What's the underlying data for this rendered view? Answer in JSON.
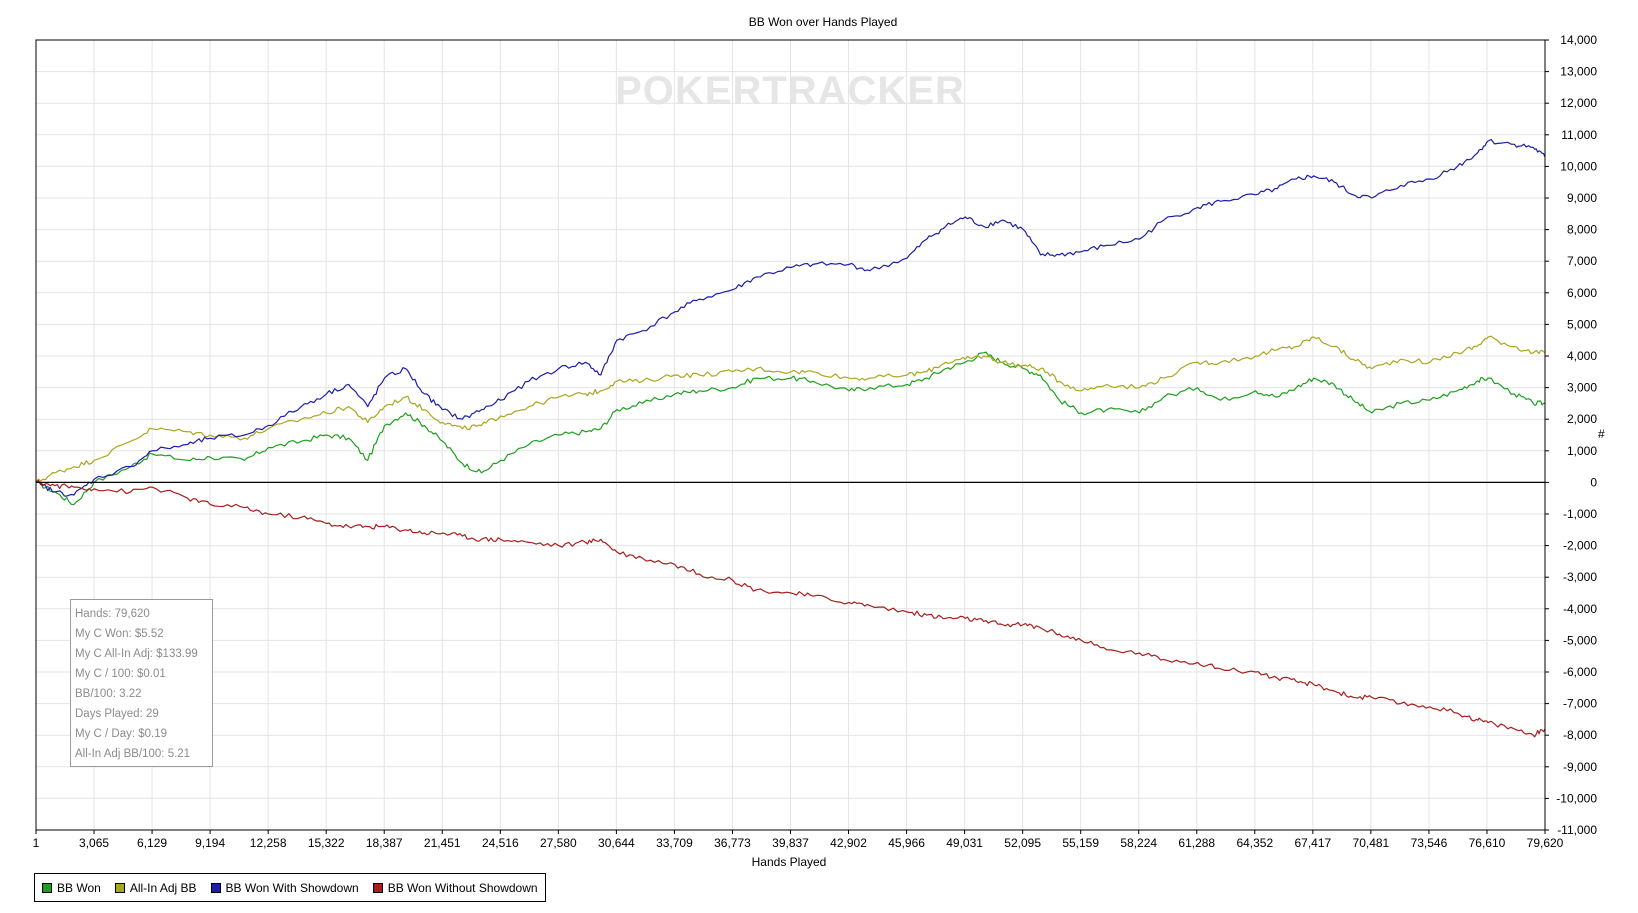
{
  "chart_data": {
    "type": "line",
    "title": "BB Won over Hands Played",
    "xlabel": "Hands Played",
    "ylabel": "",
    "watermark": "POKERTRACKER",
    "xlim": [
      1,
      79620
    ],
    "ylim": [
      -11000,
      14000
    ],
    "x_ticks": [
      "1",
      "3,065",
      "6,129",
      "9,194",
      "12,258",
      "15,322",
      "18,387",
      "21,451",
      "24,516",
      "27,580",
      "30,644",
      "33,709",
      "36,773",
      "39,837",
      "42,902",
      "45,966",
      "49,031",
      "52,095",
      "55,159",
      "58,224",
      "61,288",
      "64,352",
      "67,417",
      "70,481",
      "73,546",
      "76,610",
      "79,620"
    ],
    "y_ticks": [
      "14,000",
      "13,000",
      "12,000",
      "11,000",
      "10,000",
      "9,000",
      "8,000",
      "7,000",
      "6,000",
      "5,000",
      "4,000",
      "3,000",
      "2,000",
      "1,000",
      "0",
      "-1,000",
      "-2,000",
      "-3,000",
      "-4,000",
      "-5,000",
      "-6,000",
      "-7,000",
      "-8,000",
      "-9,000",
      "-10,000",
      "-11,000"
    ],
    "y_tick_values": [
      14000,
      13000,
      12000,
      11000,
      10000,
      9000,
      8000,
      7000,
      6000,
      5000,
      4000,
      3000,
      2000,
      1000,
      0,
      -1000,
      -2000,
      -3000,
      -4000,
      -5000,
      -6000,
      -7000,
      -8000,
      -9000,
      -10000,
      -11000
    ],
    "grid": true,
    "legend_position": "bottom-left",
    "right_axis_mark": "#",
    "series": [
      {
        "name": "BB Won",
        "color": "#1ea01e",
        "x": [
          1,
          1000,
          2000,
          3065,
          5000,
          6129,
          8000,
          9194,
          11000,
          12258,
          14000,
          15322,
          16500,
          17500,
          18387,
          19500,
          20500,
          21451,
          22500,
          23500,
          24516,
          26000,
          27580,
          29000,
          29800,
          30644,
          32000,
          33709,
          35000,
          36773,
          38000,
          39837,
          41000,
          42902,
          44000,
          45966,
          47000,
          48000,
          49031,
          50000,
          51000,
          52095,
          53000,
          54000,
          55159,
          56500,
          58224,
          59500,
          61288,
          62500,
          64352,
          65500,
          66500,
          67417,
          68500,
          69500,
          70481,
          72000,
          73546,
          75000,
          76000,
          76610,
          78000,
          79000,
          79620
        ],
        "y": [
          0,
          -300,
          -700,
          0,
          500,
          900,
          700,
          800,
          700,
          1100,
          1300,
          1500,
          1400,
          700,
          1800,
          2200,
          1800,
          1300,
          600,
          300,
          700,
          1200,
          1500,
          1600,
          1700,
          2300,
          2500,
          2800,
          2900,
          3000,
          3300,
          3300,
          3200,
          2900,
          3000,
          3100,
          3300,
          3600,
          3800,
          4100,
          3800,
          3600,
          3400,
          2600,
          2200,
          2300,
          2200,
          2700,
          3000,
          2600,
          2900,
          2700,
          3000,
          3300,
          3100,
          2600,
          2200,
          2500,
          2600,
          2900,
          3200,
          3300,
          2800,
          2500,
          2500
        ]
      },
      {
        "name": "All-In Adj BB",
        "color": "#a8a81e",
        "x": [
          1,
          1000,
          2000,
          3065,
          5000,
          6129,
          8000,
          9194,
          11000,
          12258,
          14000,
          15322,
          16500,
          17500,
          18387,
          19500,
          20500,
          21451,
          22500,
          23500,
          24516,
          26000,
          27580,
          29000,
          29800,
          30644,
          32000,
          33709,
          35000,
          36773,
          38000,
          39837,
          41000,
          42902,
          44000,
          45966,
          47000,
          48000,
          49031,
          50000,
          51000,
          52095,
          53000,
          54000,
          55159,
          56500,
          58224,
          59500,
          61288,
          62500,
          64352,
          65500,
          66500,
          67417,
          68500,
          69500,
          70481,
          72000,
          73546,
          75000,
          76000,
          76610,
          78000,
          79000,
          79620
        ],
        "y": [
          0,
          300,
          500,
          700,
          1300,
          1700,
          1600,
          1500,
          1400,
          1700,
          2000,
          2200,
          2400,
          1900,
          2400,
          2700,
          2300,
          1900,
          1700,
          1800,
          2100,
          2400,
          2700,
          2800,
          2900,
          3200,
          3200,
          3400,
          3400,
          3500,
          3600,
          3500,
          3500,
          3300,
          3300,
          3400,
          3500,
          3800,
          3900,
          4000,
          3800,
          3700,
          3600,
          3200,
          2900,
          3100,
          3000,
          3300,
          3800,
          3800,
          4000,
          4200,
          4300,
          4600,
          4300,
          3900,
          3600,
          3900,
          3800,
          4100,
          4300,
          4600,
          4300,
          4100,
          4100
        ]
      },
      {
        "name": "BB Won With Showdown",
        "color": "#1e1ea8",
        "x": [
          1,
          1000,
          2000,
          3065,
          5000,
          6129,
          8000,
          9194,
          11000,
          12258,
          14000,
          15322,
          16500,
          17500,
          18387,
          19500,
          20500,
          21451,
          22500,
          23500,
          24516,
          26000,
          27580,
          29000,
          29800,
          30644,
          32000,
          33709,
          35000,
          36773,
          38000,
          39837,
          41000,
          42902,
          44000,
          45966,
          47000,
          48000,
          49031,
          50000,
          51000,
          52095,
          53000,
          54000,
          55159,
          56500,
          58224,
          59500,
          61288,
          62500,
          64352,
          65500,
          66500,
          67417,
          68500,
          69500,
          70481,
          72000,
          73546,
          75000,
          76000,
          76610,
          78000,
          79000,
          79620
        ],
        "y": [
          0,
          -300,
          -400,
          100,
          500,
          1000,
          1200,
          1400,
          1500,
          1800,
          2400,
          2800,
          3100,
          2400,
          3300,
          3600,
          2800,
          2300,
          2000,
          2300,
          2600,
          3200,
          3600,
          3800,
          3400,
          4500,
          4800,
          5400,
          5800,
          6100,
          6500,
          6800,
          6900,
          6900,
          6700,
          7100,
          7700,
          8100,
          8400,
          8100,
          8300,
          8000,
          7200,
          7200,
          7300,
          7500,
          7700,
          8300,
          8700,
          8900,
          9100,
          9300,
          9600,
          9700,
          9500,
          9100,
          9000,
          9400,
          9600,
          10000,
          10400,
          10800,
          10700,
          10600,
          10300
        ]
      },
      {
        "name": "BB Won Without Showdown",
        "color": "#a81e1e",
        "x": [
          1,
          1000,
          2000,
          3065,
          5000,
          6129,
          8000,
          9194,
          11000,
          12258,
          14000,
          15322,
          16500,
          17500,
          18387,
          19500,
          20500,
          21451,
          22500,
          23500,
          24516,
          26000,
          27580,
          29000,
          29800,
          30644,
          32000,
          33709,
          35000,
          36773,
          38000,
          39837,
          41000,
          42902,
          44000,
          45966,
          47000,
          48000,
          49031,
          50000,
          51000,
          52095,
          53000,
          54000,
          55159,
          56500,
          58224,
          59500,
          61288,
          62500,
          64352,
          65500,
          66500,
          67417,
          68500,
          69500,
          70481,
          72000,
          73546,
          75000,
          76000,
          76610,
          78000,
          79000,
          79620
        ],
        "y": [
          0,
          -100,
          -150,
          -200,
          -300,
          -150,
          -500,
          -700,
          -800,
          -1000,
          -1100,
          -1300,
          -1400,
          -1400,
          -1400,
          -1500,
          -1600,
          -1600,
          -1700,
          -1800,
          -1800,
          -1900,
          -2000,
          -1900,
          -1800,
          -2200,
          -2400,
          -2600,
          -2900,
          -3100,
          -3400,
          -3500,
          -3600,
          -3800,
          -3900,
          -4100,
          -4200,
          -4300,
          -4300,
          -4400,
          -4500,
          -4500,
          -4600,
          -4800,
          -5000,
          -5300,
          -5400,
          -5600,
          -5700,
          -5900,
          -6000,
          -6200,
          -6300,
          -6400,
          -6600,
          -6800,
          -6800,
          -7000,
          -7100,
          -7300,
          -7500,
          -7600,
          -7800,
          -8000,
          -7800
        ]
      }
    ]
  },
  "stats": [
    "Hands: 79,620",
    "My C Won: $5.52",
    "My C All-In Adj: $133.99",
    "My C / 100: $0.01",
    "BB/100: 3.22",
    "Days Played: 29",
    "My C / Day: $0.19",
    "All-In Adj BB/100: 5.21"
  ],
  "colors": {
    "frame": "#000000",
    "grid": "#e4e4e4",
    "zero_line": "#000000"
  }
}
